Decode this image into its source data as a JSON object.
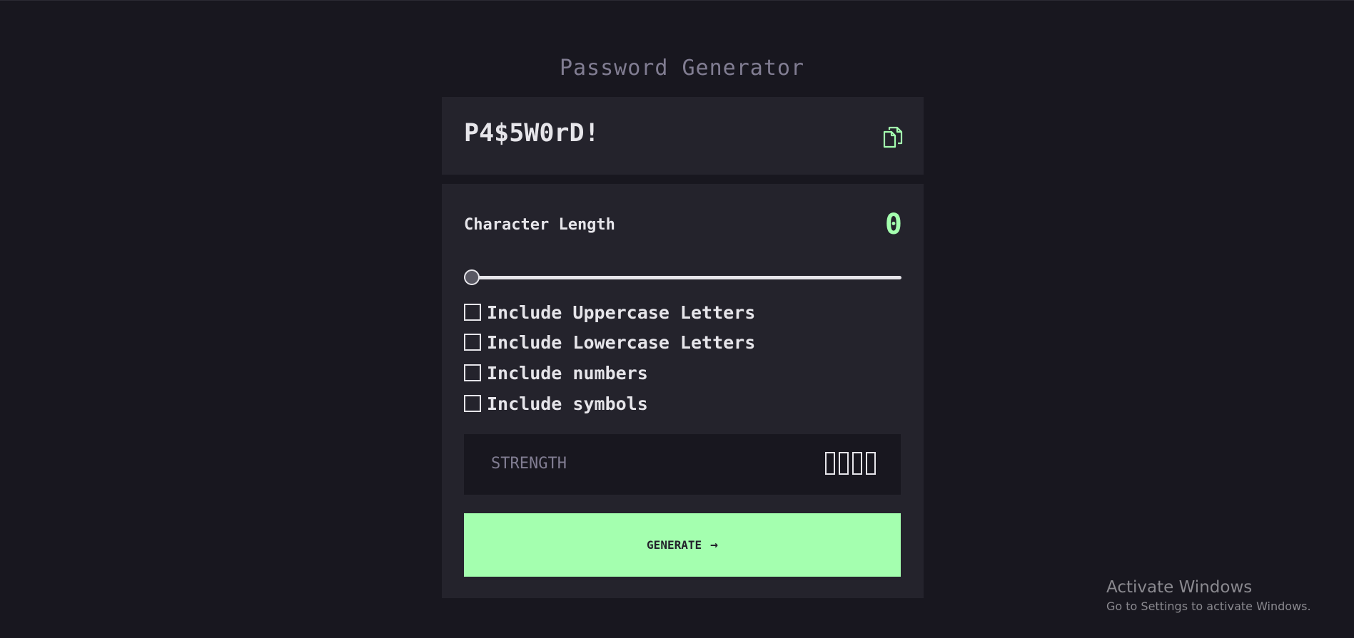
{
  "app": {
    "title": "Password Generator"
  },
  "password": {
    "value": "P4$5W0rD!",
    "copy_icon": "copy-icon"
  },
  "settings": {
    "length_label": "Character Length",
    "length_value": "0",
    "slider_fraction": 0.0,
    "options": [
      {
        "label": "Include Uppercase Letters",
        "checked": false
      },
      {
        "label": "Include Lowercase Letters",
        "checked": false
      },
      {
        "label": "Include numbers",
        "checked": false
      },
      {
        "label": "Include symbols",
        "checked": false
      }
    ],
    "strength_label": "STRENGTH",
    "strength_bars_filled": 0,
    "generate_label": "GENERATE",
    "generate_icon": "arrow-right-icon"
  },
  "watermark": {
    "title": "Activate Windows",
    "subtitle": "Go to Settings to activate Windows."
  },
  "colors": {
    "background": "#18171f",
    "panel": "#24232c",
    "accent": "#a4ffaf",
    "text": "#e6e5ea",
    "muted": "#817d92"
  }
}
